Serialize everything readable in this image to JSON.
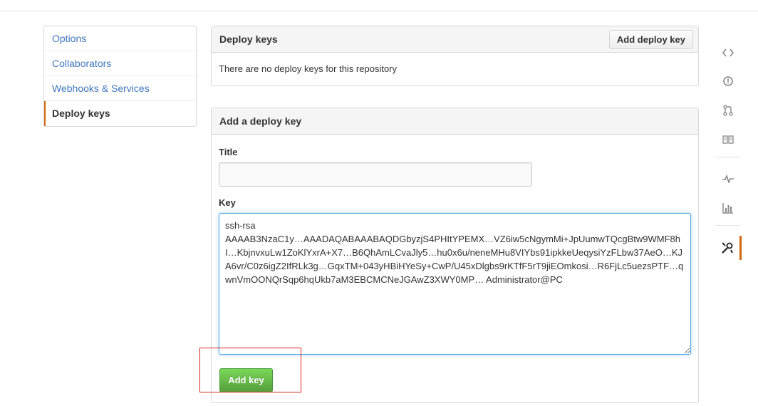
{
  "sidebar": {
    "items": [
      {
        "label": "Options"
      },
      {
        "label": "Collaborators"
      },
      {
        "label": "Webhooks & Services"
      },
      {
        "label": "Deploy keys",
        "selected": true
      }
    ]
  },
  "deploy_keys": {
    "heading": "Deploy keys",
    "add_button": "Add deploy key",
    "empty_message": "There are no deploy keys for this repository"
  },
  "add_form": {
    "heading": "Add a deploy key",
    "title_label": "Title",
    "title_value": "",
    "key_label": "Key",
    "key_value": "ssh-rsa\nAAAAB3NzaC1y…AAADAQABAAABAQDGbyzjS4PHItYPEMX…VZ6iw5cNgymMi+JpUumwTQcgBtw9WMF8hI…KbjnvxuLw1ZoKlYxrA+X7…B6QhAmLCvaJly5…hu0x6u/neneMHu8VIYbs91ipkkeUeqysiYzFLbw37AeO…KJA6vr/C0z6igZ2IfRLk3g…GqxTM+043yHBiHYeSy+CwP/U45xDlgbs9rKTfF5rT9jiEOmkosi…R6FjLc5uezsPTF…qwnVmOONQrSqp6hqUkb7aM3EBCMCNeJGAwZ3XWY0MP… Administrator@PC",
    "submit_button": "Add key"
  },
  "right_rail": {
    "icons": [
      "code-icon",
      "issues-icon",
      "pull-request-icon",
      "wiki-icon",
      "pulse-icon",
      "graphs-icon",
      "settings-icon"
    ]
  },
  "colors": {
    "link": "#4078c0",
    "accent_selected": "#d26911",
    "primary_button": "#6cc644",
    "focus": "#51a7e8",
    "annotation": "#d9261c"
  }
}
